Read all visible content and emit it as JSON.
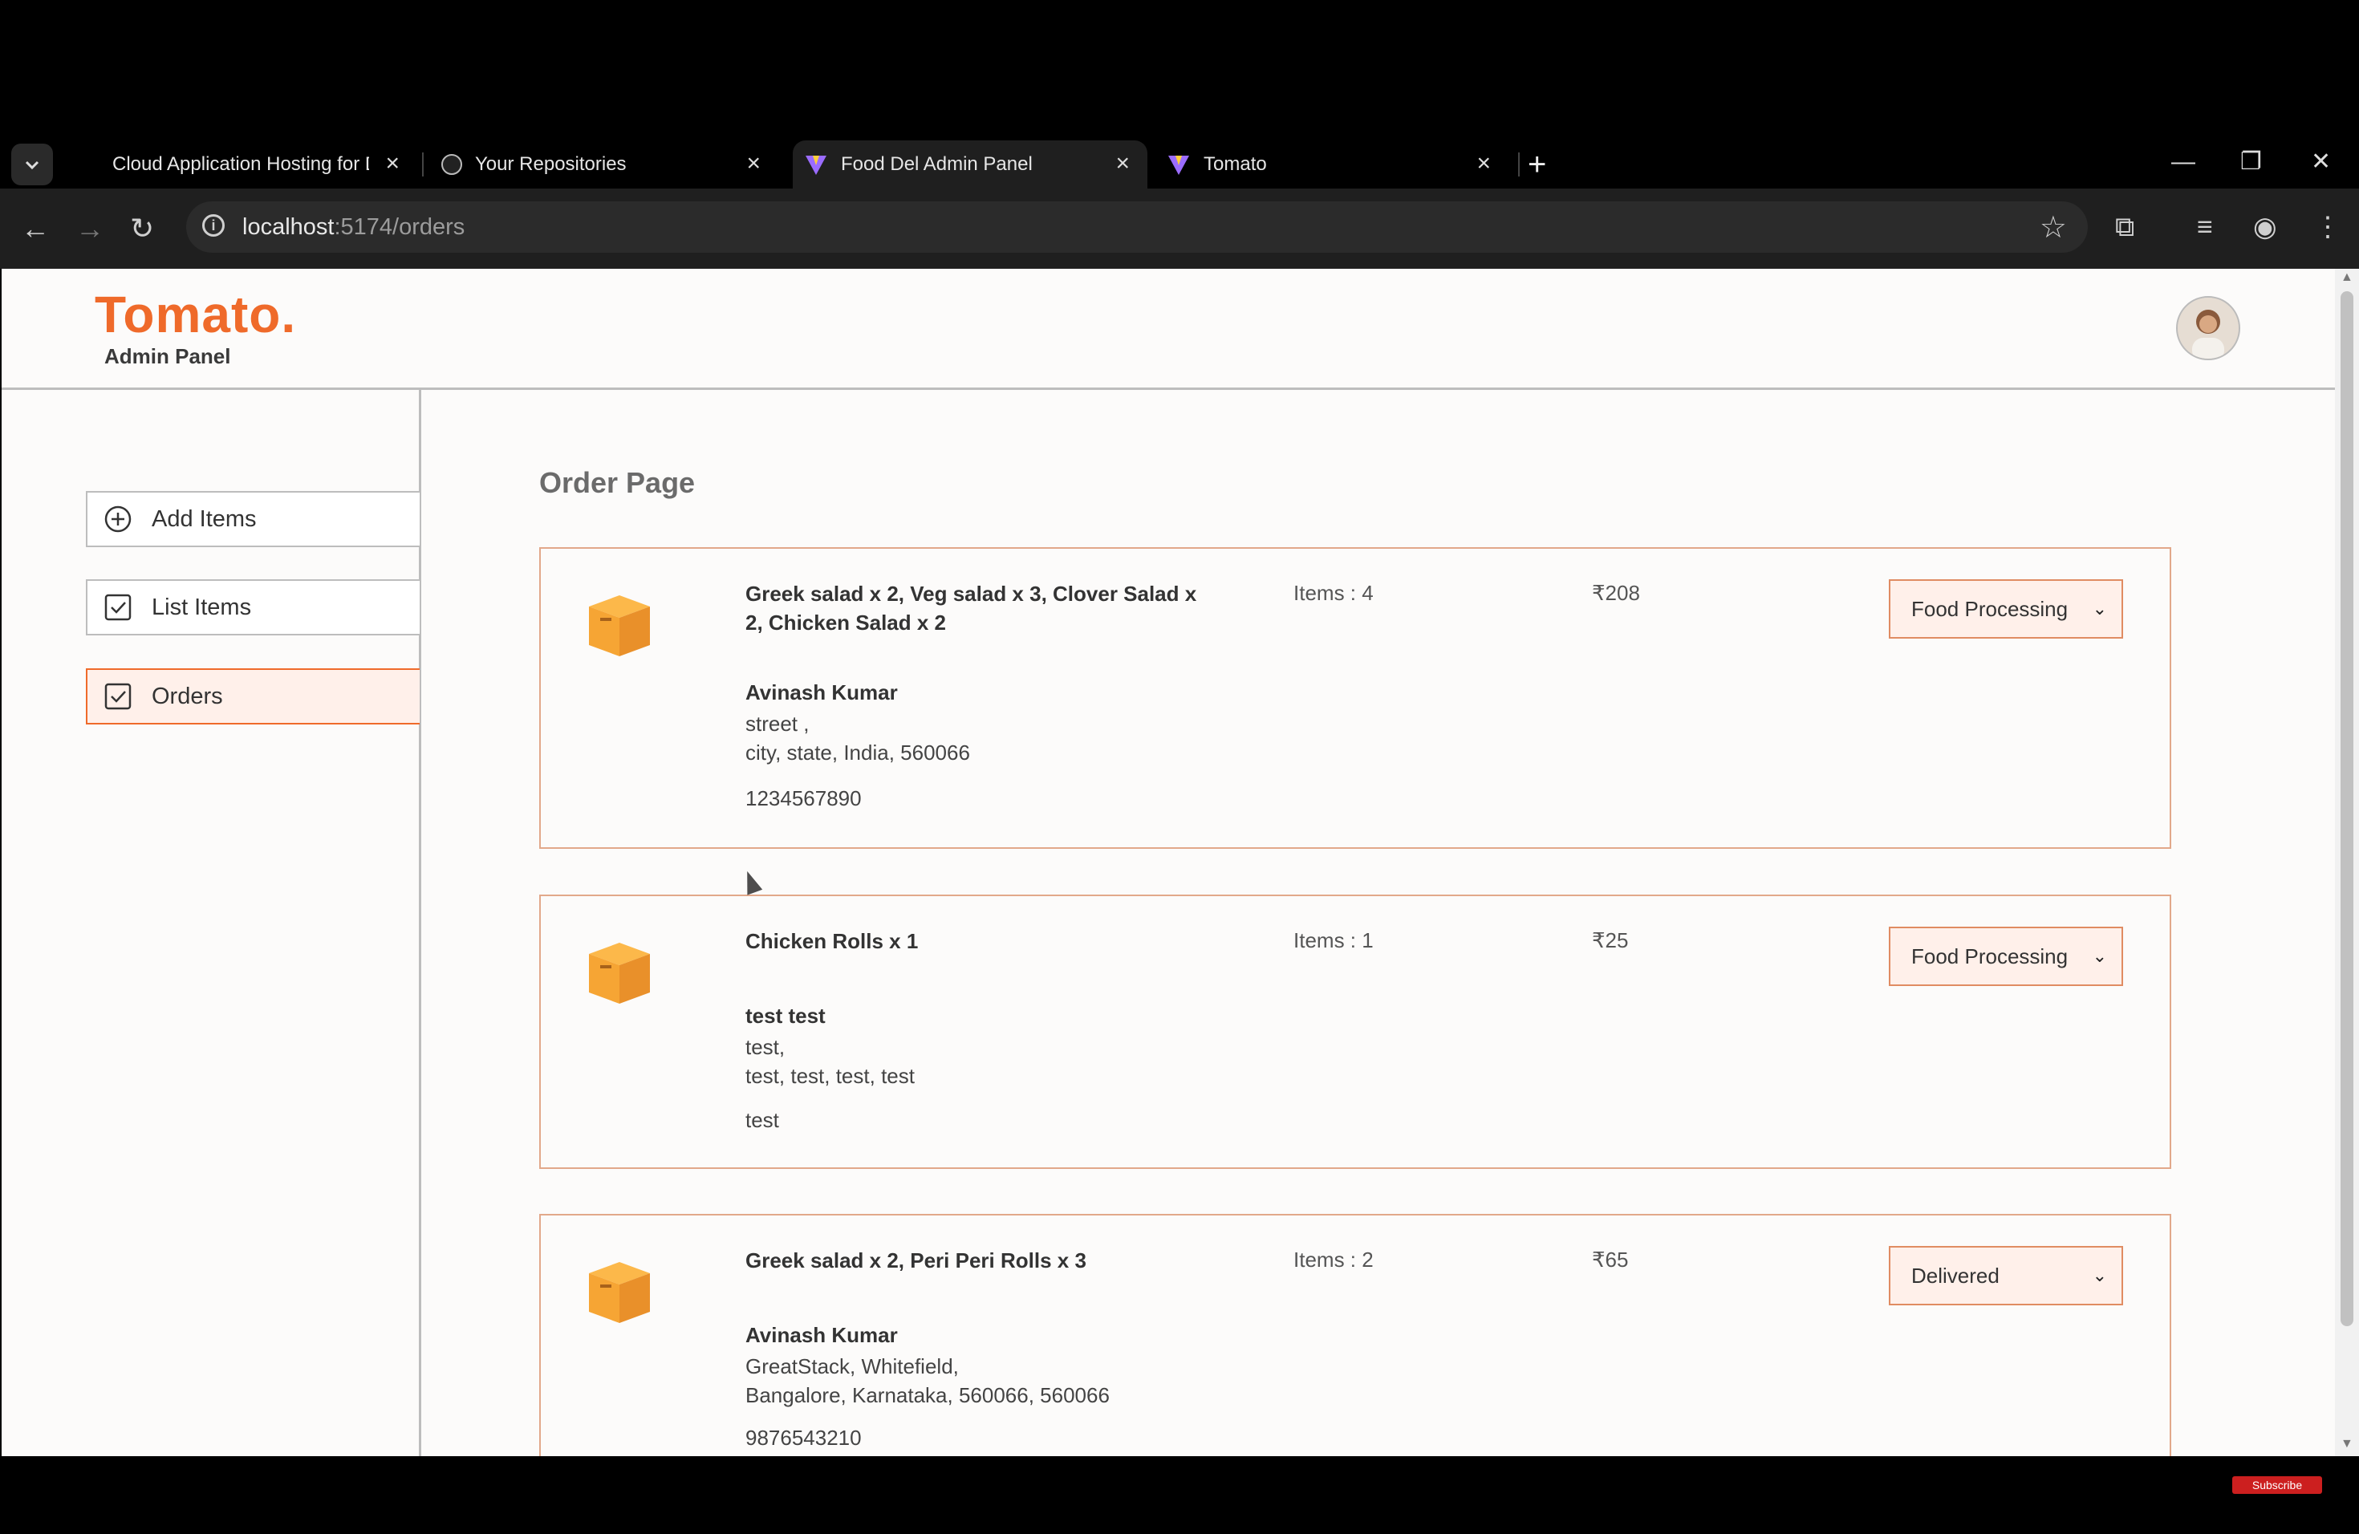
{
  "browser": {
    "tabs": [
      {
        "title": "Cloud Application Hosting for D",
        "icon": "cloud-favicon"
      },
      {
        "title": "Your Repositories",
        "icon": "github-favicon"
      },
      {
        "title": "Food Del Admin Panel",
        "icon": "vite-favicon",
        "active": true
      },
      {
        "title": "Tomato",
        "icon": "vite-favicon"
      }
    ],
    "url_host": "localhost",
    "url_path": ":5174/orders"
  },
  "header": {
    "logo": "Tomato.",
    "subtitle": "Admin Panel"
  },
  "sidebar": {
    "items": [
      {
        "label": "Add Items",
        "icon": "plus-circle-icon"
      },
      {
        "label": "List Items",
        "icon": "checkbox-icon"
      },
      {
        "label": "Orders",
        "icon": "checkbox-icon",
        "active": true
      }
    ]
  },
  "main": {
    "title": "Order Page",
    "orders": [
      {
        "items": "Greek salad x 2, Veg salad x 3, Clover Salad x 2, Chicken Salad x 2",
        "name": "Avinash Kumar",
        "street": "street ,",
        "city_line": "city, state, India, 560066",
        "phone": "1234567890",
        "count": "Items : 4",
        "amount": "₹208",
        "status": "Food Processing"
      },
      {
        "items": "Chicken Rolls x 1",
        "name": "test test",
        "street": "test,",
        "city_line": "test, test, test, test",
        "phone": "test",
        "count": "Items : 1",
        "amount": "₹25",
        "status": "Food Processing"
      },
      {
        "items": "Greek salad x 2, Peri Peri Rolls x 3",
        "name": "Avinash Kumar",
        "street": "GreatStack, Whitefield,",
        "city_line": "Bangalore, Karnataka, 560066, 560066",
        "phone": "9876543210",
        "count": "Items : 2",
        "amount": "₹65",
        "status": "Delivered"
      }
    ]
  },
  "overlay": {
    "badge": "Subscribe"
  }
}
